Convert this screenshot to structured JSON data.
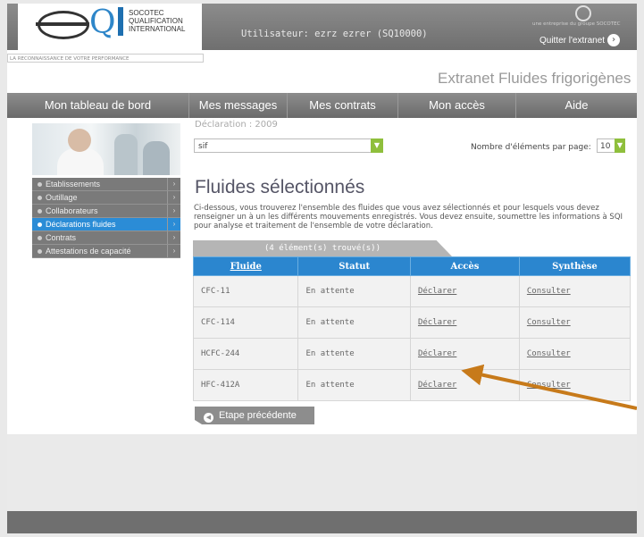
{
  "header": {
    "logo_name": "SOCOTEC QUALIFICATION INTERNATIONAL",
    "logo_line1": "SOCOTEC",
    "logo_line2": "QUALIFICATION",
    "logo_line3": "INTERNATIONAL",
    "tagline": "LA RECONNAISSANCE DE VOTRE PERFORMANCE",
    "user": "Utilisateur: ezrz ezrer (SQ10000)",
    "group_text": "une entreprise du groupe SOCOTEC",
    "quit_label": "Quitter l'extranet",
    "site_title": "Extranet Fluides frigorigènes"
  },
  "nav": {
    "items": [
      {
        "label": "Mon tableau de bord"
      },
      {
        "label": "Mes messages"
      },
      {
        "label": "Mes contrats"
      },
      {
        "label": "Mon accès"
      },
      {
        "label": "Aide"
      }
    ]
  },
  "sidebar": {
    "items": [
      {
        "label": "Etablissements",
        "active": false
      },
      {
        "label": "Outillage",
        "active": false
      },
      {
        "label": "Collaborateurs",
        "active": false
      },
      {
        "label": "Déclarations fluides",
        "active": true
      },
      {
        "label": "Contrats",
        "active": false
      },
      {
        "label": "Attestations de capacité",
        "active": false
      }
    ]
  },
  "main": {
    "declaration": "Déclaration  : 2009",
    "select_value": "sif",
    "per_page_label": "Nombre d'éléments par page:",
    "per_page_value": "10",
    "title": "Fluides sélectionnés",
    "description": "Ci-dessous, vous trouverez l'ensemble des fluides que vous avez sélectionnés et pour lesquels vous devez renseigner un à un les différents mouvements enregistrés. Vous devez ensuite, soumettre les informations à SQI pour analyse et traitement de l'ensemble de votre déclaration.",
    "found": "(4 élément(s) trouvé(s))",
    "columns": [
      "Fluide",
      "Statut",
      "Accès",
      "Synthèse"
    ],
    "rows": [
      {
        "fluide": "CFC-11",
        "statut": "En attente",
        "acces": "Déclarer",
        "synthese": "Consulter"
      },
      {
        "fluide": "CFC-114",
        "statut": "En attente",
        "acces": "Déclarer",
        "synthese": "Consulter"
      },
      {
        "fluide": "HCFC-244",
        "statut": "En attente",
        "acces": "Déclarer",
        "synthese": "Consulter"
      },
      {
        "fluide": "HFC-412A",
        "statut": "En attente",
        "acces": "Déclarer",
        "synthese": "Consulter"
      }
    ],
    "prev_label": "Etape précédente"
  },
  "colors": {
    "accent_blue": "#2b86cf",
    "nav_gray": "#7a7a7a",
    "annotation_arrow": "#c77a1a",
    "select_button": "#8fbf3c"
  }
}
